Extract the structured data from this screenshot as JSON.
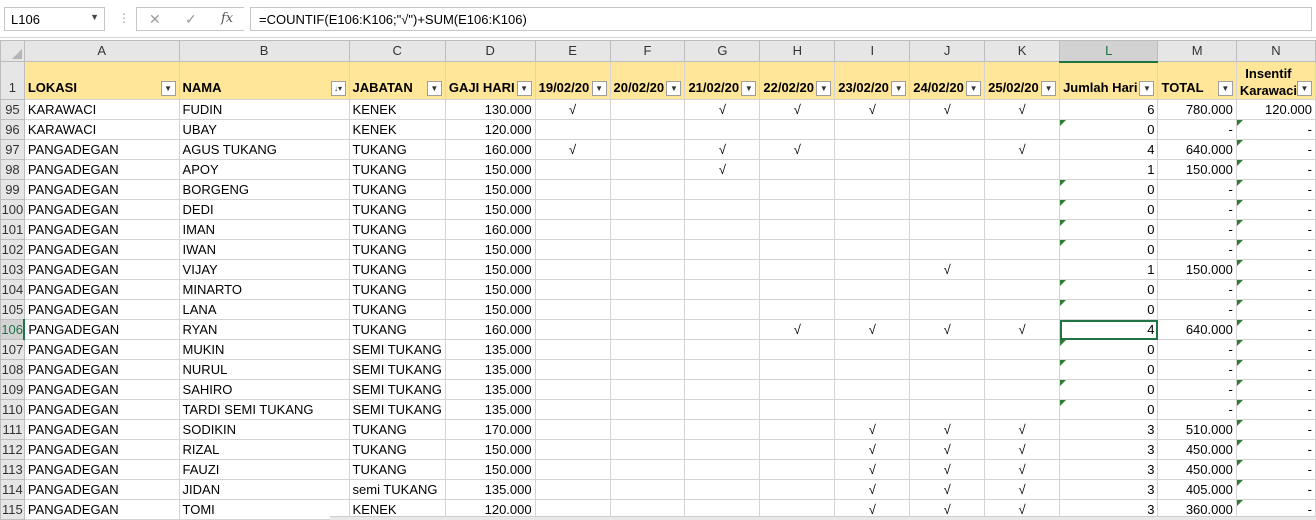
{
  "formula_bar": {
    "name_box": "L106",
    "formula": "=COUNTIF(E106:K106;\"√\")+SUM(E106:K106)"
  },
  "column_letters": [
    "A",
    "B",
    "C",
    "D",
    "E",
    "F",
    "G",
    "H",
    "I",
    "J",
    "K",
    "L",
    "M",
    "N"
  ],
  "selected_column": "L",
  "header_row": {
    "row_number": "1",
    "cells": [
      "LOKASI",
      "NAMA",
      "JABATAN",
      "GAJI HARI",
      "19/02/20",
      "20/02/20",
      "21/02/20",
      "22/02/20",
      "23/02/20",
      "24/02/20",
      "25/02/20",
      "Jumlah Hari",
      "TOTAL",
      "Insentif Karawaci"
    ]
  },
  "selected_row": "106",
  "rows": [
    {
      "n": "95",
      "cells": [
        "KARAWACI",
        "FUDIN",
        "KENEK",
        "130.000",
        "√",
        "",
        "√",
        "√",
        "√",
        "√",
        "√",
        "6",
        "780.000",
        "120.000"
      ]
    },
    {
      "n": "96",
      "cells": [
        "KARAWACI",
        "UBAY",
        "KENEK",
        "120.000",
        "",
        "",
        "",
        "",
        "",
        "",
        "",
        "0",
        "-",
        "-"
      ]
    },
    {
      "n": "97",
      "cells": [
        "PANGADEGAN",
        "AGUS TUKANG",
        "TUKANG",
        "160.000",
        "√",
        "",
        "√",
        "√",
        "",
        "",
        "√",
        "4",
        "640.000",
        "-"
      ]
    },
    {
      "n": "98",
      "cells": [
        "PANGADEGAN",
        "APOY",
        "TUKANG",
        "150.000",
        "",
        "",
        "√",
        "",
        "",
        "",
        "",
        "1",
        "150.000",
        "-"
      ]
    },
    {
      "n": "99",
      "cells": [
        "PANGADEGAN",
        "BORGENG",
        "TUKANG",
        "150.000",
        "",
        "",
        "",
        "",
        "",
        "",
        "",
        "0",
        "-",
        "-"
      ]
    },
    {
      "n": "100",
      "cells": [
        "PANGADEGAN",
        "DEDI",
        "TUKANG",
        "150.000",
        "",
        "",
        "",
        "",
        "",
        "",
        "",
        "0",
        "-",
        "-"
      ]
    },
    {
      "n": "101",
      "cells": [
        "PANGADEGAN",
        "IMAN",
        "TUKANG",
        "160.000",
        "",
        "",
        "",
        "",
        "",
        "",
        "",
        "0",
        "-",
        "-"
      ]
    },
    {
      "n": "102",
      "cells": [
        "PANGADEGAN",
        "IWAN",
        "TUKANG",
        "150.000",
        "",
        "",
        "",
        "",
        "",
        "",
        "",
        "0",
        "-",
        "-"
      ]
    },
    {
      "n": "103",
      "cells": [
        "PANGADEGAN",
        "VIJAY",
        "TUKANG",
        "150.000",
        "",
        "",
        "",
        "",
        "",
        "√",
        "",
        "1",
        "150.000",
        "-"
      ]
    },
    {
      "n": "104",
      "cells": [
        "PANGADEGAN",
        "MINARTO",
        "TUKANG",
        "150.000",
        "",
        "",
        "",
        "",
        "",
        "",
        "",
        "0",
        "-",
        "-"
      ]
    },
    {
      "n": "105",
      "cells": [
        "PANGADEGAN",
        "LANA",
        "TUKANG",
        "150.000",
        "",
        "",
        "",
        "",
        "",
        "",
        "",
        "0",
        "-",
        "-"
      ]
    },
    {
      "n": "106",
      "cells": [
        "PANGADEGAN",
        "RYAN",
        "TUKANG",
        "160.000",
        "",
        "",
        "",
        "√",
        "√",
        "√",
        "√",
        "4",
        "640.000",
        "-"
      ]
    },
    {
      "n": "107",
      "cells": [
        "PANGADEGAN",
        "MUKIN",
        "SEMI TUKANG",
        "135.000",
        "",
        "",
        "",
        "",
        "",
        "",
        "",
        "0",
        "-",
        "-"
      ]
    },
    {
      "n": "108",
      "cells": [
        "PANGADEGAN",
        "NURUL",
        "SEMI TUKANG",
        "135.000",
        "",
        "",
        "",
        "",
        "",
        "",
        "",
        "0",
        "-",
        "-"
      ]
    },
    {
      "n": "109",
      "cells": [
        "PANGADEGAN",
        "SAHIRO",
        "SEMI TUKANG",
        "135.000",
        "",
        "",
        "",
        "",
        "",
        "",
        "",
        "0",
        "-",
        "-"
      ]
    },
    {
      "n": "110",
      "cells": [
        "PANGADEGAN",
        "TARDI SEMI TUKANG",
        "SEMI TUKANG",
        "135.000",
        "",
        "",
        "",
        "",
        "",
        "",
        "",
        "0",
        "-",
        "-"
      ]
    },
    {
      "n": "111",
      "cells": [
        "PANGADEGAN",
        "SODIKIN",
        "TUKANG",
        "170.000",
        "",
        "",
        "",
        "",
        "√",
        "√",
        "√",
        "3",
        "510.000",
        "-"
      ]
    },
    {
      "n": "112",
      "cells": [
        "PANGADEGAN",
        "RIZAL",
        "TUKANG",
        "150.000",
        "",
        "",
        "",
        "",
        "√",
        "√",
        "√",
        "3",
        "450.000",
        "-"
      ]
    },
    {
      "n": "113",
      "cells": [
        "PANGADEGAN",
        "FAUZI",
        "TUKANG",
        "150.000",
        "",
        "",
        "",
        "",
        "√",
        "√",
        "√",
        "3",
        "450.000",
        "-"
      ]
    },
    {
      "n": "114",
      "cells": [
        "PANGADEGAN",
        "JIDAN",
        "semi TUKANG",
        "135.000",
        "",
        "",
        "",
        "",
        "√",
        "√",
        "√",
        "3",
        "405.000",
        "-"
      ]
    },
    {
      "n": "115",
      "cells": [
        "PANGADEGAN",
        "TOMI",
        "KENEK",
        "120.000",
        "",
        "",
        "",
        "",
        "√",
        "√",
        "√",
        "3",
        "360.000",
        "-"
      ]
    }
  ]
}
